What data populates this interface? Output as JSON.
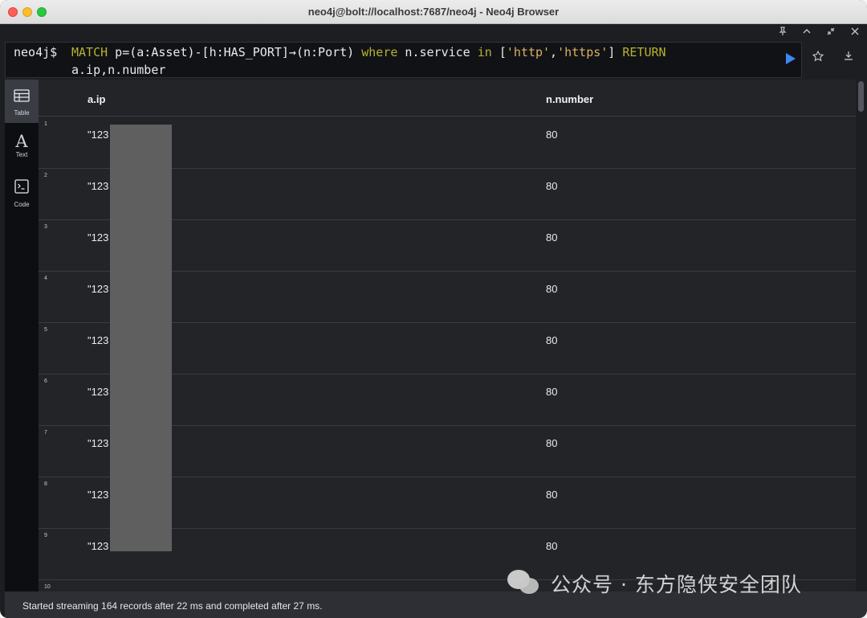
{
  "window": {
    "title": "neo4j@bolt://localhost:7687/neo4j - Neo4j Browser"
  },
  "frame_controls": {
    "pin_icon": "pin-icon",
    "collapse_icon": "chevron-up-icon",
    "fullscreen_icon": "shrink-icon",
    "close_icon": "close-icon"
  },
  "editor": {
    "prompt": "neo4j$",
    "query_parts": {
      "match": "MATCH",
      "pattern": " p=(a:Asset)-[h:HAS_PORT]→(n:Port) ",
      "where": "where",
      "prop": " n.service ",
      "in": "in",
      "list_open": " [",
      "s1": "'http'",
      "comma": ",",
      "s2": "'https'",
      "list_close": "] ",
      "ret": "RETURN"
    },
    "query_line2": "a.ip,n.number"
  },
  "views": [
    {
      "label": "Table",
      "icon": "table-icon"
    },
    {
      "label": "Text",
      "icon": "text-icon"
    },
    {
      "label": "Code",
      "icon": "code-icon"
    }
  ],
  "table": {
    "columns": [
      "a.ip",
      "n.number"
    ],
    "rows": [
      {
        "num": "1",
        "ip": "\"123",
        "port": "80"
      },
      {
        "num": "2",
        "ip": "\"123",
        "port": "80"
      },
      {
        "num": "3",
        "ip": "\"123",
        "port": "80"
      },
      {
        "num": "4",
        "ip": "\"123",
        "port": "80"
      },
      {
        "num": "5",
        "ip": "\"123",
        "port": "80"
      },
      {
        "num": "6",
        "ip": "\"123",
        "port": "80"
      },
      {
        "num": "7",
        "ip": "\"123",
        "port": "80"
      },
      {
        "num": "8",
        "ip": "\"123",
        "port": "80"
      },
      {
        "num": "9",
        "ip": "\"123",
        "port": "80"
      },
      {
        "num": "10",
        "ip": "",
        "port": ""
      }
    ]
  },
  "status": {
    "message": "Started streaming 164 records after 22 ms and completed after 27 ms."
  },
  "watermark": {
    "text": "公众号 · 东方隐侠安全团队",
    "icon": "wechat-icon"
  },
  "colors": {
    "keyword": "#b8b12f",
    "string": "#d9b25f",
    "play": "#3d86f6"
  }
}
